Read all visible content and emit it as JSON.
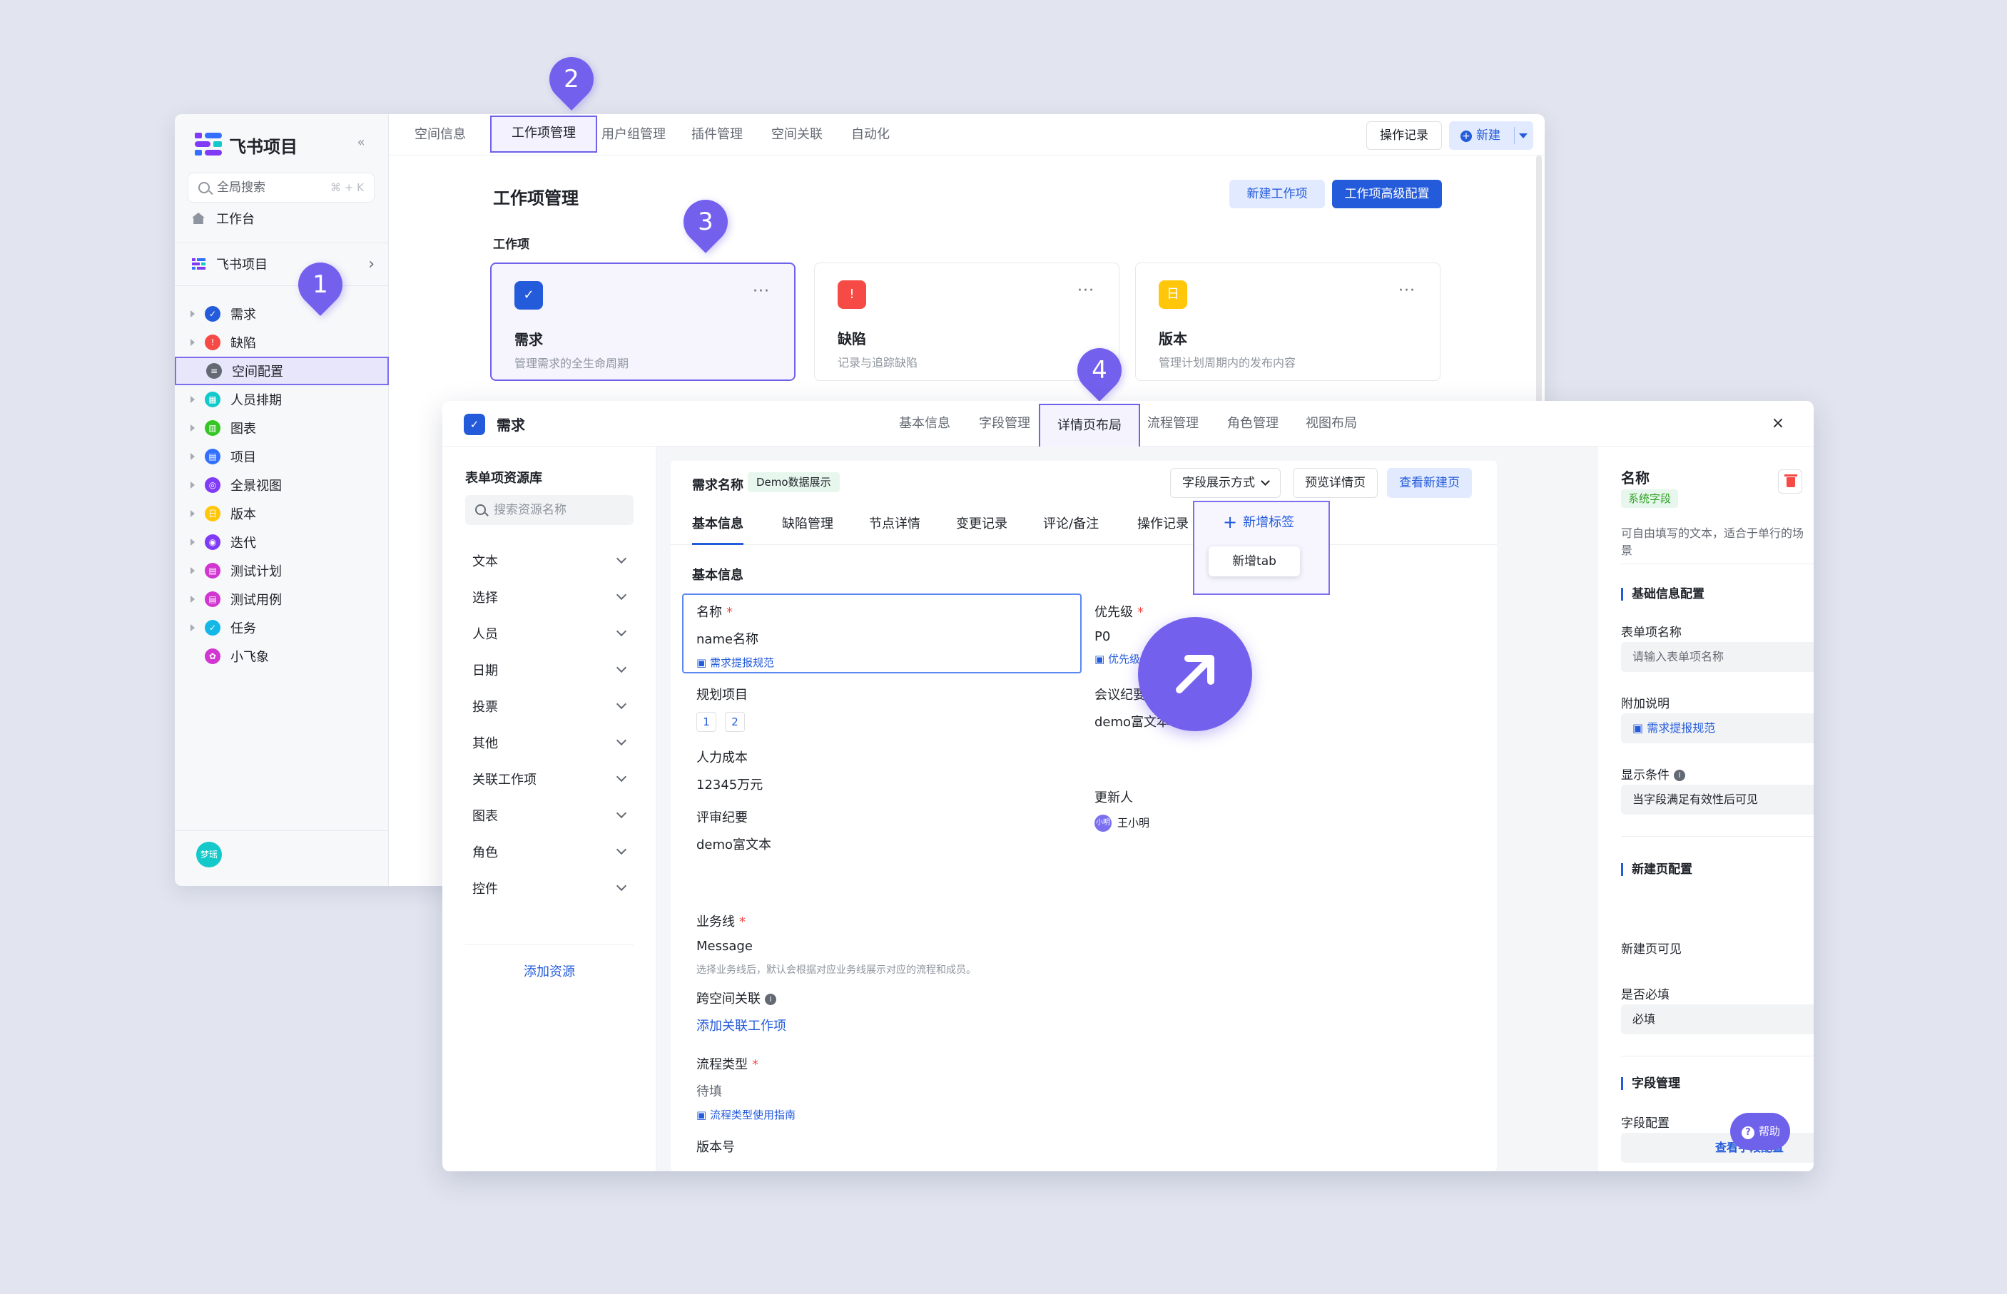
{
  "app": {
    "logo_text": "飞书项目",
    "collapse_icon": "«"
  },
  "sidebar": {
    "search_placeholder": "全局搜索",
    "search_shortcut": "⌘ + K",
    "workbench": "工作台",
    "space_name": "飞书项目",
    "items": [
      {
        "label": "需求",
        "color": "#245bdb",
        "icon": "check-circle-icon",
        "caret": true
      },
      {
        "label": "缺陷",
        "color": "#f54a45",
        "icon": "alert-icon",
        "caret": true
      },
      {
        "label": "空间配置",
        "color": "#646a73",
        "icon": "list-icon",
        "caret": false,
        "selected": true
      },
      {
        "label": "人员排期",
        "color": "#14c9c9",
        "icon": "calendar-icon",
        "caret": true
      },
      {
        "label": "图表",
        "color": "#34c724",
        "icon": "chart-icon",
        "caret": true
      },
      {
        "label": "项目",
        "color": "#3370ff",
        "icon": "folder-icon",
        "caret": true
      },
      {
        "label": "全景视图",
        "color": "#7f3bf5",
        "icon": "panorama-icon",
        "caret": true
      },
      {
        "label": "版本",
        "color": "#ffc60a",
        "icon": "version-icon",
        "caret": true
      },
      {
        "label": "迭代",
        "color": "#7f3bf5",
        "icon": "iteration-icon",
        "caret": true
      },
      {
        "label": "测试计划",
        "color": "#d136d1",
        "icon": "test-plan-icon",
        "caret": true
      },
      {
        "label": "测试用例",
        "color": "#d136d1",
        "icon": "test-case-icon",
        "caret": true
      },
      {
        "label": "任务",
        "color": "#14b8e6",
        "icon": "task-icon",
        "caret": true
      },
      {
        "label": "小飞象",
        "color": "#d136d1",
        "icon": "elephant-icon",
        "caret": false
      }
    ],
    "avatar_text": "梦瑶"
  },
  "topbar": {
    "tabs": [
      "空间信息",
      "工作项管理",
      "用户组管理",
      "插件管理",
      "空间关联",
      "自动化"
    ],
    "selected_tab": 1,
    "op_log": "操作记录",
    "new_label": "新建"
  },
  "workitem": {
    "title": "工作项管理",
    "new_btn": "新建工作项",
    "adv_btn": "工作项高级配置",
    "section": "工作项",
    "cards": [
      {
        "title": "需求",
        "desc": "管理需求的全生命周期",
        "color": "#245bdb",
        "icon": "check-circle-icon",
        "glyph": "✓"
      },
      {
        "title": "缺陷",
        "desc": "记录与追踪缺陷",
        "color": "#f54a45",
        "icon": "alert-icon",
        "glyph": "!"
      },
      {
        "title": "版本",
        "desc": "管理计划周期内的发布内容",
        "color": "#ffc60a",
        "icon": "version-icon",
        "glyph": "日"
      }
    ]
  },
  "pins": [
    "1",
    "2",
    "3",
    "4"
  ],
  "modal": {
    "title": "需求",
    "tabs": [
      "基本信息",
      "字段管理",
      "详情页布局",
      "流程管理",
      "角色管理",
      "视图布局"
    ],
    "selected_tab": 2,
    "close": "×"
  },
  "library": {
    "title": "表单项资源库",
    "search_placeholder": "搜索资源名称",
    "items": [
      "文本",
      "选择",
      "人员",
      "日期",
      "投票",
      "其他",
      "关联工作项",
      "图表",
      "角色",
      "控件"
    ],
    "add": "添加资源"
  },
  "canvas": {
    "name_label": "需求名称",
    "name_tag": "Demo数据展示",
    "display_mode": "字段展示方式",
    "preview": "预览详情页",
    "view_new": "查看新建页",
    "tabs": [
      "基本信息",
      "缺陷管理",
      "节点详情",
      "变更记录",
      "评论/备注",
      "操作记录"
    ],
    "add_tab": "新增标签",
    "add_tab_item": "新增tab",
    "section": "基本信息",
    "fields": {
      "name": {
        "label": "名称",
        "value": "name名称",
        "hint": "需求提报规范"
      },
      "priority": {
        "label": "优先级",
        "value": "P0",
        "hint": "优先级"
      },
      "plan_project": {
        "label": "规划项目",
        "chips": [
          "1",
          "2"
        ]
      },
      "meeting": {
        "label": "会议纪要",
        "value": "demo富文本"
      },
      "manpower": {
        "label": "人力成本",
        "value": "12345万元"
      },
      "updater": {
        "label": "更新人",
        "value": "王小明",
        "avatar": "小明"
      },
      "review": {
        "label": "评审纪要",
        "value": "demo富文本"
      },
      "business": {
        "label": "业务线",
        "value": "Message",
        "note": "选择业务线后，默认会根据对应业务线展示对应的流程和成员。"
      },
      "cross_space": {
        "label": "跨空间关联",
        "link": "添加关联工作项"
      },
      "flow_type": {
        "label": "流程类型",
        "value": "待填",
        "hint": "流程类型使用指南"
      },
      "version_no": {
        "label": "版本号"
      }
    }
  },
  "rpanel": {
    "title": "名称",
    "badge": "系统字段",
    "desc": "可自由填写的文本，适合于单行的场景",
    "basic_section": "基础信息配置",
    "form_name_label": "表单项名称",
    "form_name_placeholder": "请输入表单项名称",
    "extra_label": "附加说明",
    "extra_value": "需求提报规范",
    "cond_label": "显示条件",
    "cond_value": "当字段满足有效性后可见",
    "newpage_section": "新建页配置",
    "visible_label": "新建页可见",
    "visible_on": true,
    "required_label": "是否必填",
    "required_value": "必填",
    "field_section": "字段管理",
    "field_cfg_label": "字段配置",
    "field_cfg_btn": "查看字段配置",
    "help": "帮助"
  }
}
